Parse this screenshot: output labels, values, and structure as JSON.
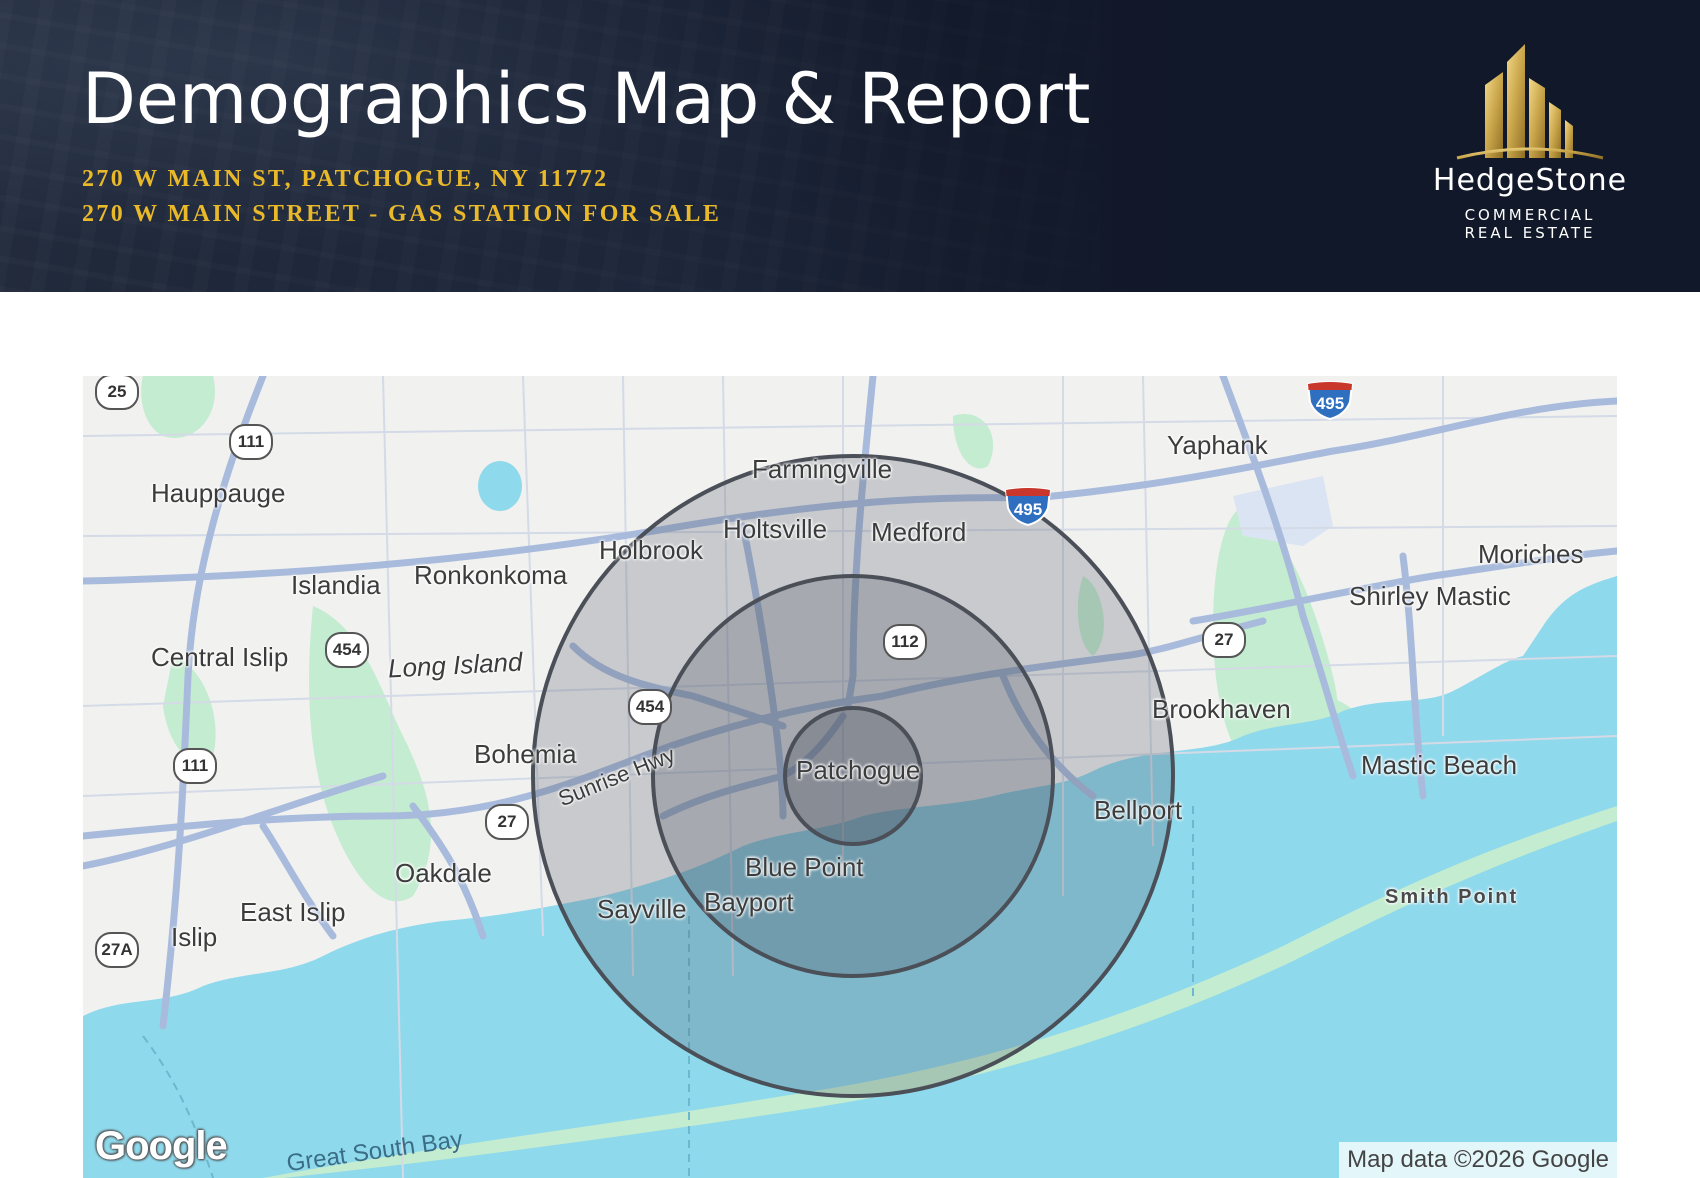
{
  "header": {
    "title": "Demographics Map & Report",
    "address_line": "270 W MAIN ST, PATCHOGUE, NY 11772",
    "property_line": "270 W MAIN STREET - GAS STATION FOR SALE"
  },
  "logo": {
    "name": "HedgeStone",
    "tagline_1": "COMMERCIAL",
    "tagline_2": "REAL ESTATE",
    "accent_color": "#c9a54a"
  },
  "map": {
    "center_label": "Patchogue",
    "radius_rings": 3,
    "ring_color": "#505660",
    "water_color": "#8fd9ec",
    "land_color": "#f1f1f0",
    "park_color": "#c4ecd0",
    "road_color": "#a9bbdc",
    "places": [
      "Farmingville",
      "Yaphank",
      "Hauppauge",
      "Holtsville",
      "Medford",
      "Holbrook",
      "Islandia",
      "Ronkonkoma",
      "Moriches",
      "Shirley Mastic",
      "Central Islip",
      "Long Island",
      "Brookhaven",
      "Bohemia",
      "Patchogue",
      "Mastic Beach",
      "Bellport",
      "Sunrise Hwy",
      "Oakdale",
      "Blue Point",
      "Smith Point",
      "Bayport",
      "Sayville",
      "East Islip",
      "Islip",
      "Great South Bay"
    ],
    "route_shields": [
      "25",
      "111",
      "454",
      "111",
      "27",
      "27A",
      "454",
      "112",
      "27"
    ],
    "interstate_shields": [
      "495",
      "495"
    ],
    "google_logo": "Google",
    "attribution": "Map data ©2026 Google"
  }
}
